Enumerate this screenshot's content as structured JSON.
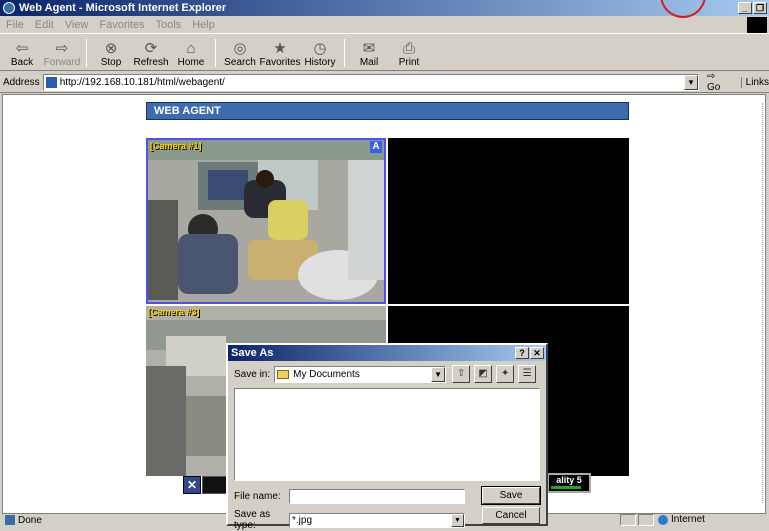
{
  "window": {
    "title": "Web Agent - Microsoft Internet Explorer"
  },
  "menu": [
    "File",
    "Edit",
    "View",
    "Favorites",
    "Tools",
    "Help"
  ],
  "toolbar": [
    {
      "label": "Back",
      "icon": "back-arrow-icon",
      "glyph": "⇦",
      "disabled": false
    },
    {
      "label": "Forward",
      "icon": "forward-arrow-icon",
      "glyph": "⇨",
      "disabled": true
    },
    {
      "label": "Stop",
      "icon": "stop-icon",
      "glyph": "⊗",
      "disabled": false
    },
    {
      "label": "Refresh",
      "icon": "refresh-icon",
      "glyph": "⟳",
      "disabled": false
    },
    {
      "label": "Home",
      "icon": "home-icon",
      "glyph": "⌂",
      "disabled": false
    },
    {
      "label": "Search",
      "icon": "search-icon",
      "glyph": "◎",
      "disabled": false
    },
    {
      "label": "Favorites",
      "icon": "favorites-icon",
      "glyph": "★",
      "disabled": false
    },
    {
      "label": "History",
      "icon": "history-icon",
      "glyph": "◷",
      "disabled": false
    },
    {
      "label": "Mail",
      "icon": "mail-icon",
      "glyph": "✉",
      "disabled": false
    },
    {
      "label": "Print",
      "icon": "print-icon",
      "glyph": "⎙",
      "disabled": false
    }
  ],
  "address": {
    "label": "Address",
    "url": "http://192.168.10.181/html/webagent/",
    "go": "Go",
    "links": "Links"
  },
  "page": {
    "header": "WEB AGENT",
    "cameras": [
      {
        "label": "[Camera #1]",
        "badge": "A"
      },
      {
        "label": "[Camera #3]"
      }
    ],
    "quality": {
      "label": "ality",
      "value": "5"
    }
  },
  "dialog": {
    "title": "Save As",
    "save_in_label": "Save in:",
    "save_in_value": "My Documents",
    "file_name_label": "File name:",
    "file_name_value": "",
    "save_type_label": "Save as type:",
    "save_type_value": "*.jpg",
    "save_button": "Save",
    "cancel_button": "Cancel"
  },
  "status": {
    "text": "Done",
    "zone": "Internet"
  },
  "colors": {
    "titlebar": "#0a246a",
    "header_bar": "#3d6bb0",
    "camera_select": "#5050f0",
    "camera_label": "#ffd000"
  }
}
